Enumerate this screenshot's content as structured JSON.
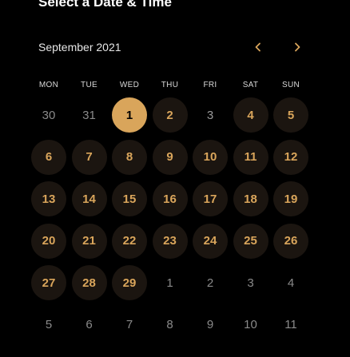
{
  "title": "Select a Date & Time",
  "calendar": {
    "month_label": "September 2021",
    "weekdays": [
      "MON",
      "TUE",
      "WED",
      "THU",
      "FRI",
      "SAT",
      "SUN"
    ],
    "accent_color": "#d9a55b",
    "weeks": [
      [
        {
          "label": "30",
          "state": "outside"
        },
        {
          "label": "31",
          "state": "outside"
        },
        {
          "label": "1",
          "state": "selected"
        },
        {
          "label": "2",
          "state": "available"
        },
        {
          "label": "3",
          "state": "unavailable"
        },
        {
          "label": "4",
          "state": "available"
        },
        {
          "label": "5",
          "state": "available"
        }
      ],
      [
        {
          "label": "6",
          "state": "available"
        },
        {
          "label": "7",
          "state": "available"
        },
        {
          "label": "8",
          "state": "available"
        },
        {
          "label": "9",
          "state": "available"
        },
        {
          "label": "10",
          "state": "available"
        },
        {
          "label": "11",
          "state": "available"
        },
        {
          "label": "12",
          "state": "available"
        }
      ],
      [
        {
          "label": "13",
          "state": "available"
        },
        {
          "label": "14",
          "state": "available"
        },
        {
          "label": "15",
          "state": "available"
        },
        {
          "label": "16",
          "state": "available"
        },
        {
          "label": "17",
          "state": "available"
        },
        {
          "label": "18",
          "state": "available"
        },
        {
          "label": "19",
          "state": "available"
        }
      ],
      [
        {
          "label": "20",
          "state": "available"
        },
        {
          "label": "21",
          "state": "available"
        },
        {
          "label": "22",
          "state": "available"
        },
        {
          "label": "23",
          "state": "available"
        },
        {
          "label": "24",
          "state": "available"
        },
        {
          "label": "25",
          "state": "available"
        },
        {
          "label": "26",
          "state": "available"
        }
      ],
      [
        {
          "label": "27",
          "state": "available"
        },
        {
          "label": "28",
          "state": "available"
        },
        {
          "label": "29",
          "state": "available"
        },
        {
          "label": "1",
          "state": "outside"
        },
        {
          "label": "2",
          "state": "outside"
        },
        {
          "label": "3",
          "state": "outside"
        },
        {
          "label": "4",
          "state": "outside"
        }
      ],
      [
        {
          "label": "5",
          "state": "outside"
        },
        {
          "label": "6",
          "state": "outside"
        },
        {
          "label": "7",
          "state": "outside"
        },
        {
          "label": "8",
          "state": "outside"
        },
        {
          "label": "9",
          "state": "outside"
        },
        {
          "label": "10",
          "state": "outside"
        },
        {
          "label": "11",
          "state": "outside"
        }
      ]
    ]
  }
}
